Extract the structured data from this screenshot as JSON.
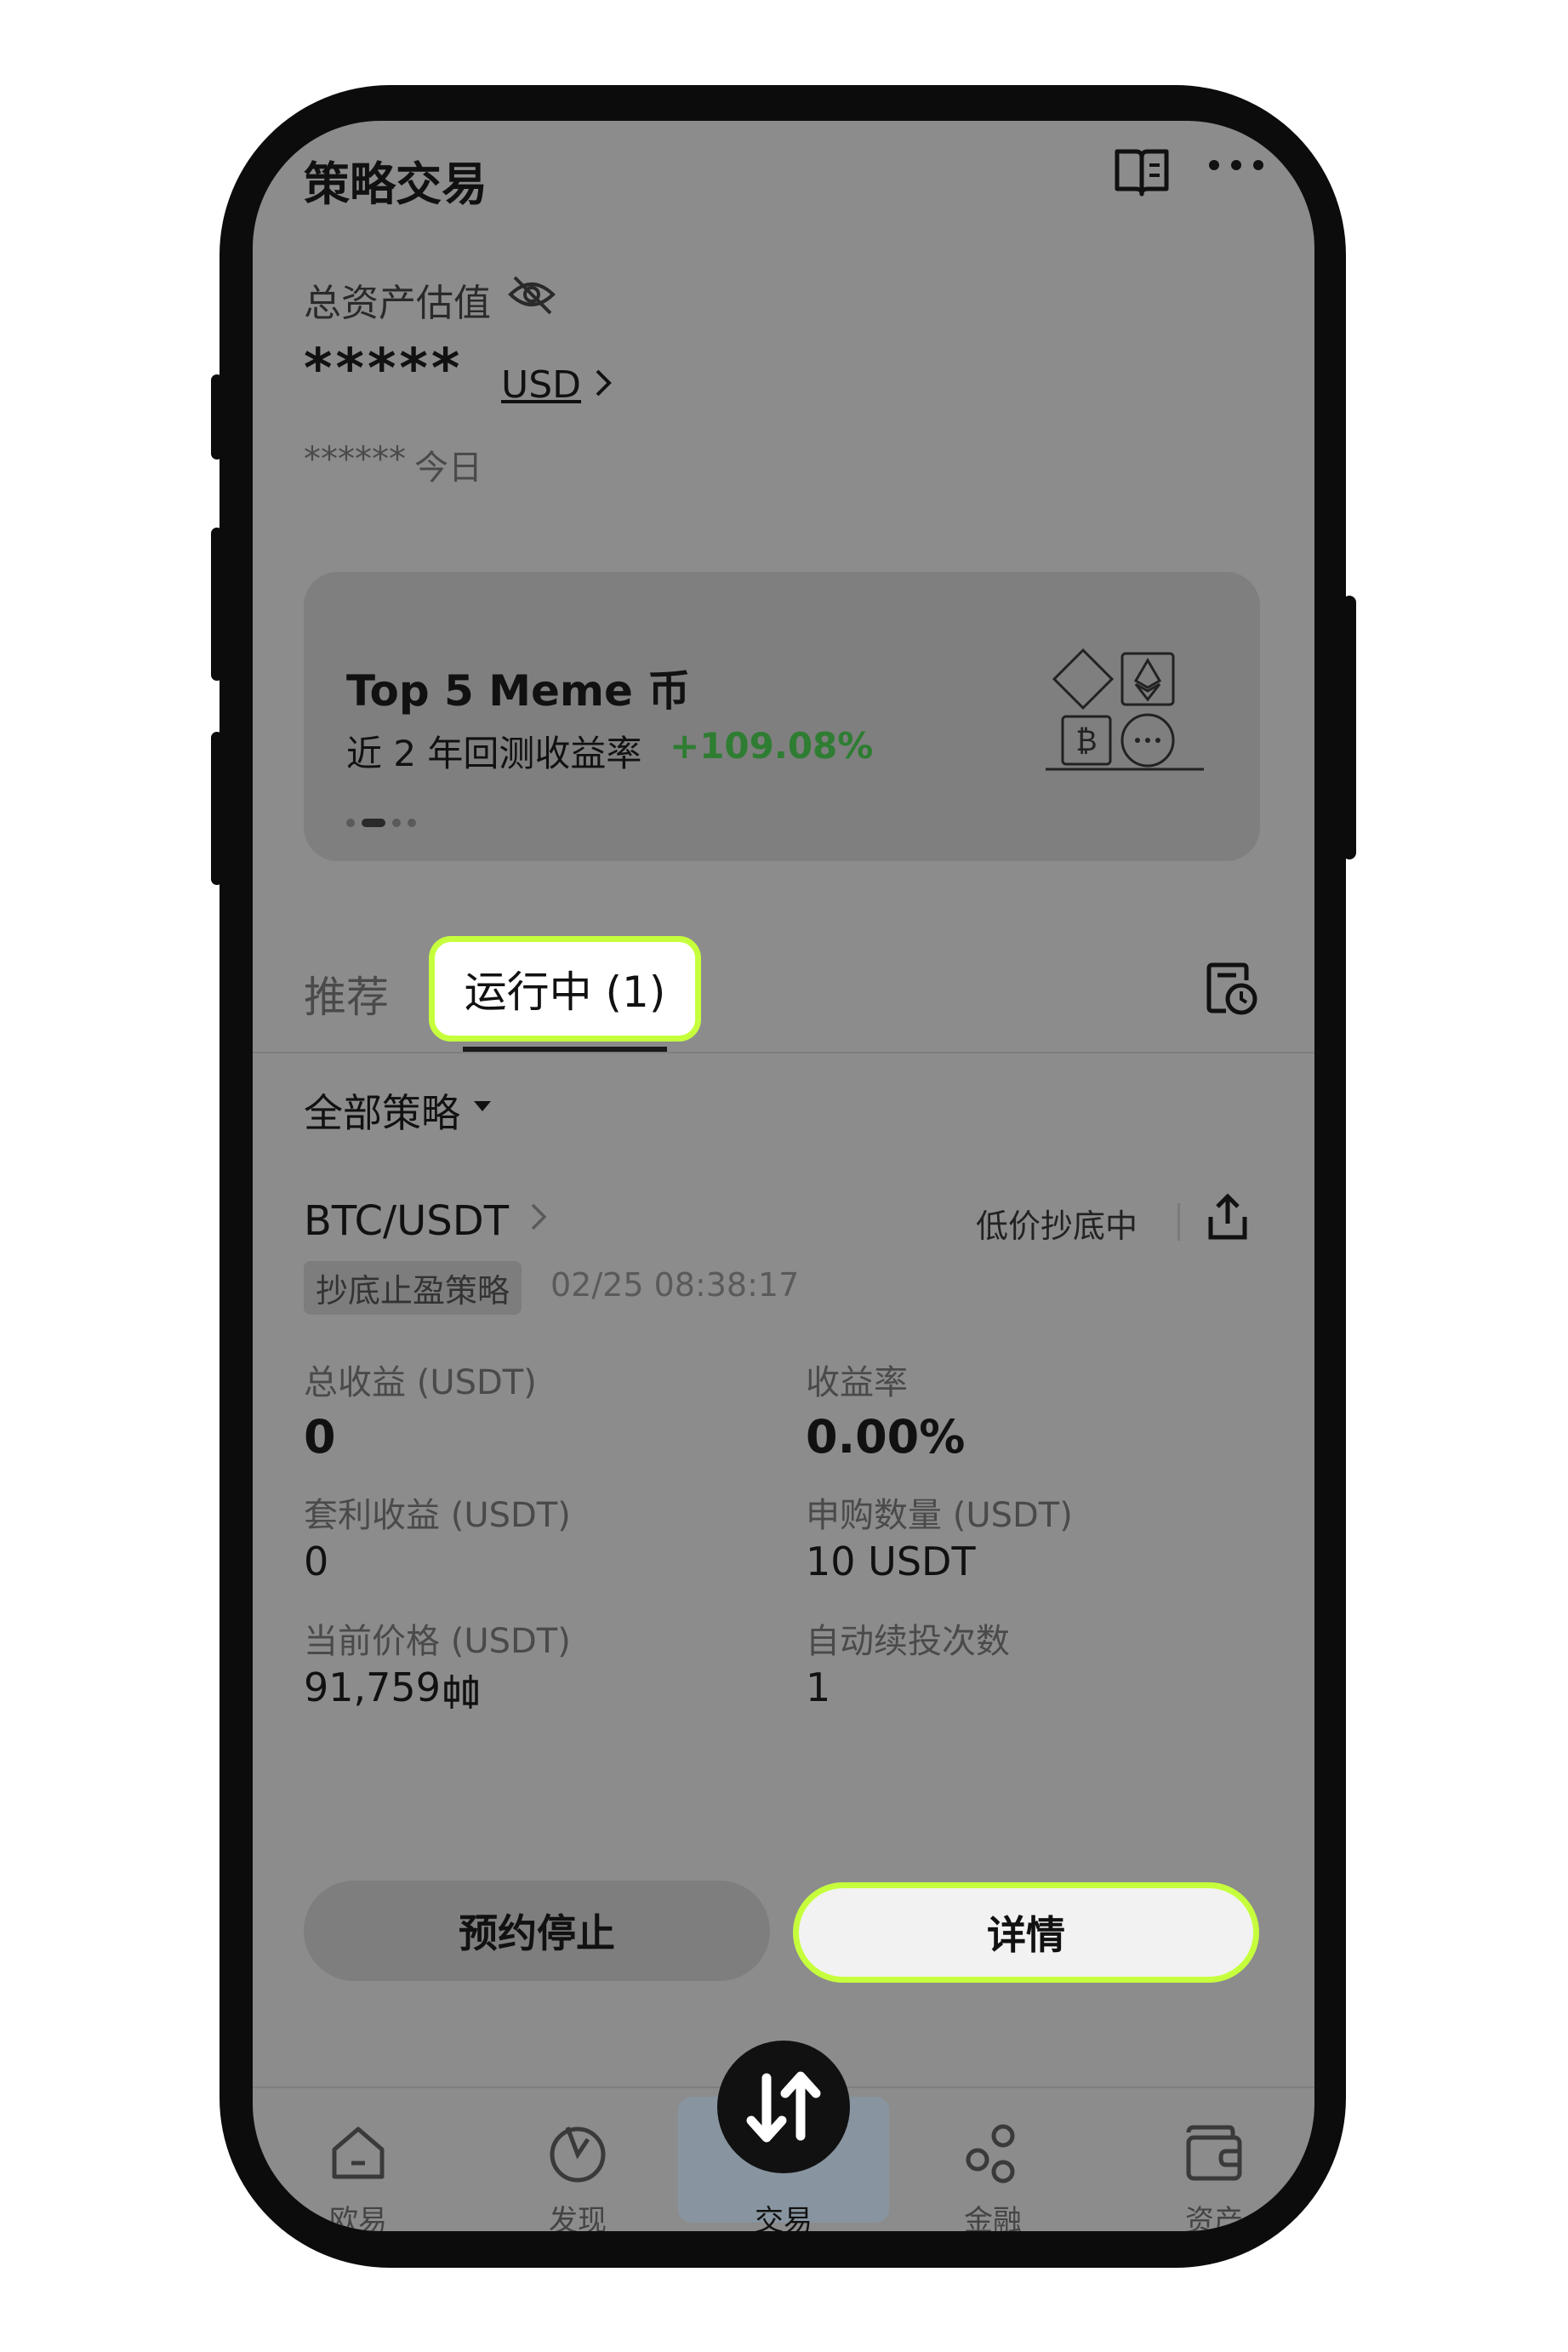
{
  "header": {
    "title": "策略交易"
  },
  "valuation": {
    "label": "总资产估值",
    "masked_value": "*****",
    "currency": "USD",
    "today_masked": "******",
    "today_label": "今日"
  },
  "banner": {
    "title": "Top 5 Meme 币",
    "subtitle": "近 2 年回测收益率",
    "return_pct": "+109.08%",
    "pager": {
      "count": 4,
      "active_index": 1
    }
  },
  "tabs": [
    {
      "label": "推荐",
      "active": false
    },
    {
      "label": "运行中 (1)",
      "active": true
    }
  ],
  "filter": {
    "label": "全部策略"
  },
  "strategy": {
    "pair": "BTC/USDT",
    "status": "低价抄底中",
    "tag": "抄底止盈策略",
    "timestamp": "02/25 08:38:17",
    "metrics": [
      {
        "label": "总收益 (USDT)",
        "value": "0"
      },
      {
        "label": "收益率",
        "value": "0.00%"
      },
      {
        "label": "套利收益 (USDT)",
        "value": "0"
      },
      {
        "label": "申购数量 (USDT)",
        "value": "10 USDT"
      },
      {
        "label": "当前价格 (USDT)",
        "value": "91,759"
      },
      {
        "label": "自动续投次数",
        "value": "1"
      }
    ],
    "stop_button": "预约停止",
    "detail_button": "详情"
  },
  "nav": [
    {
      "label": "欧易",
      "icon": "home-icon"
    },
    {
      "label": "发现",
      "icon": "discover-icon"
    },
    {
      "label": "交易",
      "icon": "trade-swap-icon",
      "active": true
    },
    {
      "label": "金融",
      "icon": "finance-icon"
    },
    {
      "label": "资产",
      "icon": "wallet-icon"
    }
  ],
  "colors": {
    "highlight": "#c6ff3c",
    "positive": "#2e7d32",
    "screen_dim": "#8c8c8c"
  }
}
